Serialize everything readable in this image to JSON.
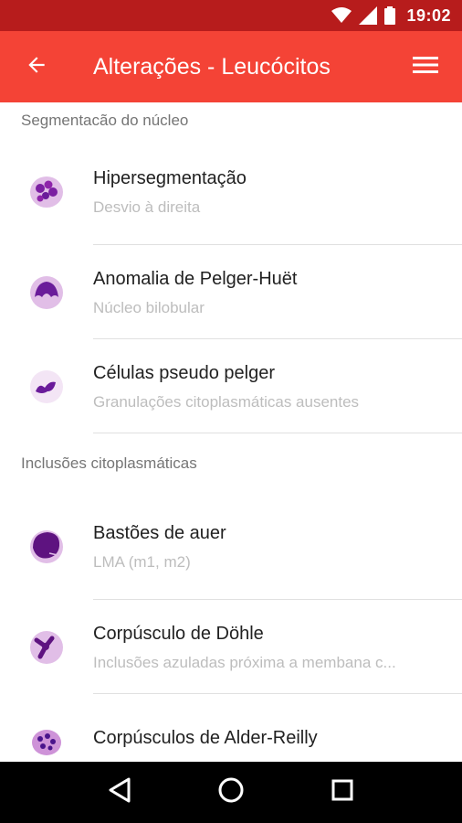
{
  "status_bar": {
    "time": "19:02",
    "icons": [
      "wifi-icon",
      "signal-icon",
      "battery-icon"
    ]
  },
  "app_bar": {
    "title": "Alterações - Leucócitos",
    "back_icon": "arrow-back-icon",
    "menu_icon": "menu-icon",
    "background": "#f44336",
    "status_background": "#b71c1c"
  },
  "sections": [
    {
      "header": "Segmentacão do núcleo",
      "items": [
        {
          "title": "Hipersegmentação",
          "subtitle": "Desvio à direita",
          "icon": "hypersegmented-cell-icon"
        },
        {
          "title": "Anomalia de Pelger-Huët",
          "subtitle": "Núcleo bilobular",
          "icon": "bilobed-cell-icon"
        },
        {
          "title": "Células pseudo pelger",
          "subtitle": "Granulações citoplasmáticas ausentes",
          "icon": "pseudo-pelger-cell-icon"
        }
      ]
    },
    {
      "header": "Inclusões citoplasmáticas",
      "items": [
        {
          "title": "Bastões de auer",
          "subtitle": "LMA (m1, m2)",
          "icon": "auer-rod-cell-icon"
        },
        {
          "title": "Corpúsculo de Döhle",
          "subtitle": "Inclusões azuladas próxima a membana c...",
          "icon": "dohle-body-cell-icon"
        },
        {
          "title": "Corpúsculos de Alder-Reilly",
          "subtitle": "",
          "icon": "alder-reilly-cell-icon"
        }
      ]
    }
  ],
  "nav_bar": {
    "icons": [
      "back-triangle-icon",
      "home-circle-icon",
      "recents-square-icon"
    ]
  }
}
